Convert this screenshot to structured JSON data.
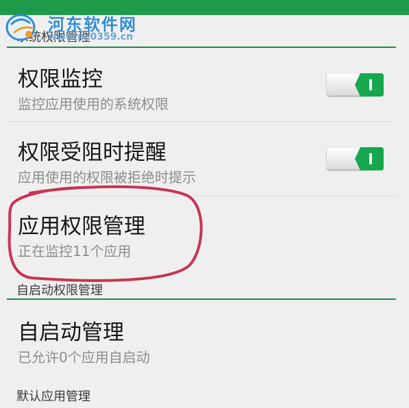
{
  "watermark": {
    "title": "河东软件网",
    "url": "www.pc0359.cn"
  },
  "sections": [
    {
      "header": "系统权限管理",
      "items": [
        {
          "title": "权限监控",
          "subtitle": "监控应用使用的系统权限",
          "toggle_on": true
        },
        {
          "title": "权限受阻时提醒",
          "subtitle": "应用使用的权限被拒绝时提示",
          "toggle_on": true
        },
        {
          "title": "应用权限管理",
          "subtitle": "正在监控11个应用"
        }
      ]
    },
    {
      "header": "自启动权限管理",
      "items": [
        {
          "title": "自启动管理",
          "subtitle": "已允许0个应用自启动"
        }
      ]
    },
    {
      "header": "默认应用管理"
    }
  ],
  "colors": {
    "status_bar": "#1f9a4a",
    "accent": "#1d8a4e",
    "toggle_on": "#17a84f",
    "annotation": "#c8344f",
    "background": "#efefef"
  }
}
